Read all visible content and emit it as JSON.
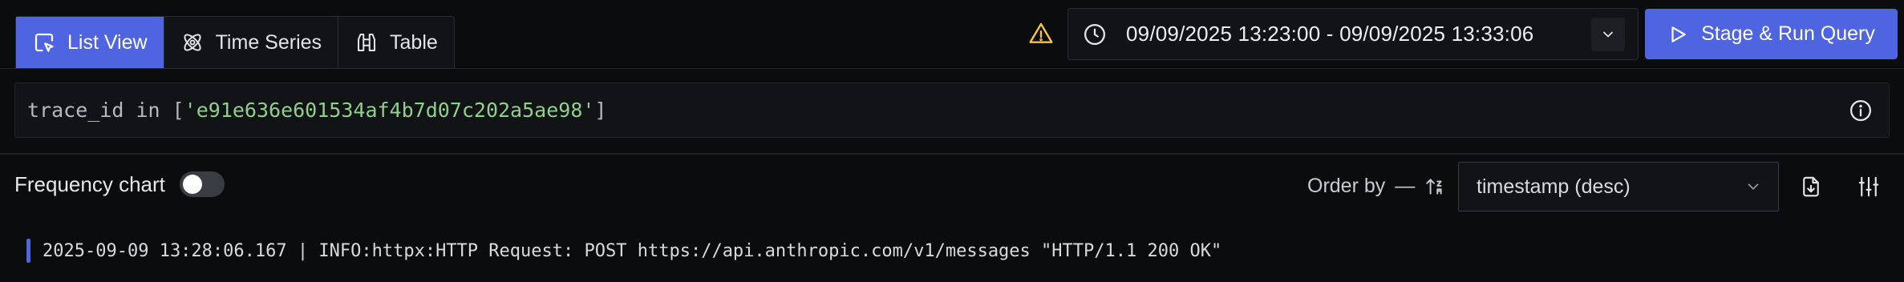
{
  "toolbar": {
    "tabs": [
      {
        "label": "List View",
        "icon": "list-view-icon",
        "active": true
      },
      {
        "label": "Time Series",
        "icon": "time-series-icon",
        "active": false
      },
      {
        "label": "Table",
        "icon": "table-icon",
        "active": false
      }
    ],
    "warning_icon": "warning-icon",
    "time_range": "09/09/2025 13:23:00 - 09/09/2025 13:33:06",
    "run_button": "Stage & Run Query"
  },
  "query": {
    "prefix": "trace_id in [",
    "value": "'e91e636e601534af4b7d07c202a5ae98'",
    "suffix": "]"
  },
  "options": {
    "frequency_chart_label": "Frequency chart",
    "frequency_chart_on": false,
    "order_by_label": "Order by",
    "order_by_dash": "—",
    "order_by_value": "timestamp (desc)"
  },
  "logs": [
    {
      "text": "2025-09-09 13:28:06.167 | INFO:httpx:HTTP Request: POST https://api.anthropic.com/v1/messages \"HTTP/1.1 200 OK\""
    }
  ],
  "colors": {
    "accent": "#4e64e0",
    "warning": "#f5c542",
    "string": "#8fd08a",
    "background": "#0b0c0e"
  }
}
